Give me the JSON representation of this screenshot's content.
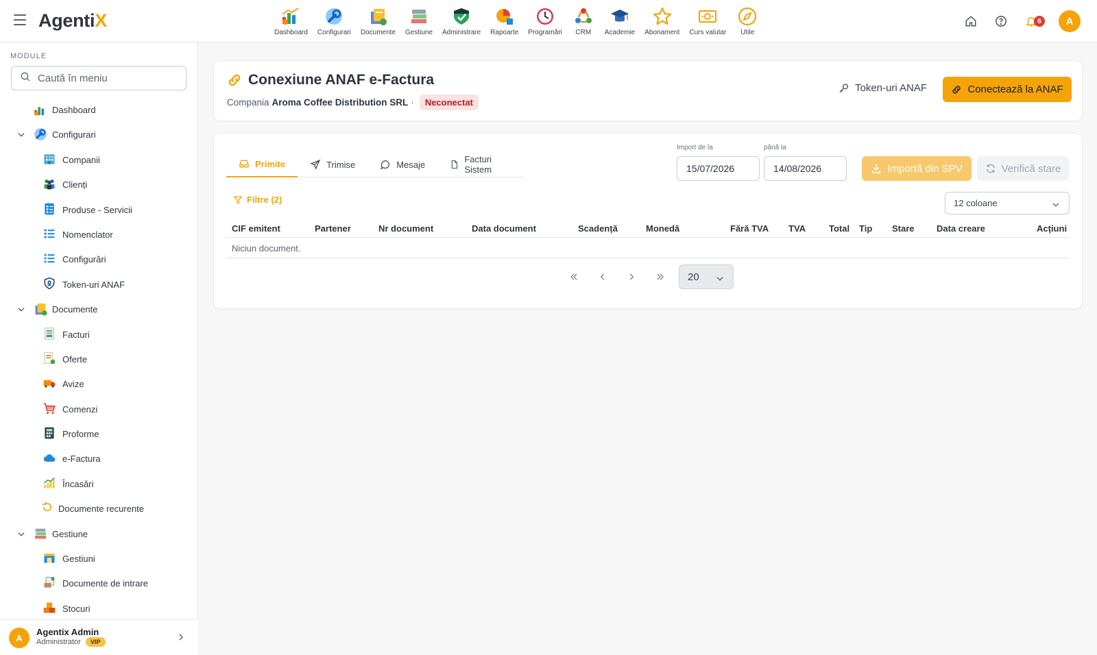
{
  "app": {
    "logo_main": "Agenti",
    "logo_accent": "X"
  },
  "top_nav": [
    {
      "label": "Dashboard",
      "icon": "dashboard-chart-icon"
    },
    {
      "label": "Configurari",
      "icon": "wrench-icon"
    },
    {
      "label": "Documente",
      "icon": "documents-icon"
    },
    {
      "label": "Gestiune",
      "icon": "books-stack-icon"
    },
    {
      "label": "Administrare",
      "icon": "shield-check-icon"
    },
    {
      "label": "Rapoarte",
      "icon": "report-pie-icon"
    },
    {
      "label": "Programări",
      "icon": "clock-icon"
    },
    {
      "label": "CRM",
      "icon": "crm-cycle-icon"
    },
    {
      "label": "Academie",
      "icon": "graduation-cap-icon"
    },
    {
      "label": "Abonament",
      "icon": "star-icon"
    },
    {
      "label": "Curs valutar",
      "icon": "banknote-icon"
    },
    {
      "label": "Utile",
      "icon": "compass-icon"
    }
  ],
  "top_right": {
    "notifications_count": "6",
    "avatar_initial": "A"
  },
  "sidebar": {
    "section_title": "MODULE",
    "search_placeholder": "Caută în meniu",
    "items": [
      {
        "label": "Dashboard",
        "level": 0,
        "icon": "dashboard-chart-icon"
      },
      {
        "label": "Configurari",
        "level": 0,
        "icon": "wrench-icon",
        "expanded": true
      },
      {
        "label": "Companii",
        "level": 1,
        "icon": "building-icon"
      },
      {
        "label": "Clienți",
        "level": 1,
        "icon": "people-icon"
      },
      {
        "label": "Produse - Servicii",
        "level": 1,
        "icon": "checklist-icon"
      },
      {
        "label": "Nomenclator",
        "level": 1,
        "icon": "list-icon"
      },
      {
        "label": "Configurări",
        "level": 1,
        "icon": "settings-list-icon"
      },
      {
        "label": "Token-uri ANAF",
        "level": 1,
        "icon": "shield-lock-icon"
      },
      {
        "label": "Documente",
        "level": 0,
        "icon": "documents-icon",
        "expanded": true
      },
      {
        "label": "Facturi",
        "level": 1,
        "icon": "invoice-icon"
      },
      {
        "label": "Oferte",
        "level": 1,
        "icon": "offer-icon"
      },
      {
        "label": "Avize",
        "level": 1,
        "icon": "truck-icon"
      },
      {
        "label": "Comenzi",
        "level": 1,
        "icon": "cart-icon"
      },
      {
        "label": "Proforme",
        "level": 1,
        "icon": "calculator-icon"
      },
      {
        "label": "e-Factura",
        "level": 1,
        "icon": "cloud-icon"
      },
      {
        "label": "Încasări",
        "level": 1,
        "icon": "growth-icon"
      },
      {
        "label": "Documente recurente",
        "level": 1,
        "icon": "recurring-icon"
      },
      {
        "label": "Gestiune",
        "level": 0,
        "icon": "books-stack-icon",
        "expanded": true
      },
      {
        "label": "Gestiuni",
        "level": 1,
        "icon": "warehouse-icon"
      },
      {
        "label": "Documente de intrare",
        "level": 1,
        "icon": "incoming-doc-icon"
      },
      {
        "label": "Stocuri",
        "level": 1,
        "icon": "boxes-icon"
      }
    ],
    "user": {
      "initial": "A",
      "name": "Agentix Admin",
      "role": "Administrator",
      "badge": "VIP"
    }
  },
  "header_card": {
    "title": "Conexiune ANAF e-Factura",
    "company_prefix": "Compania",
    "company_name": "Aroma Coffee Distribution SRL",
    "separator": "·",
    "status": "Neconectat",
    "token_link": "Token-uri ANAF",
    "connect_button": "Conectează la ANAF"
  },
  "main_card": {
    "tabs": [
      {
        "label": "Primite",
        "icon": "inbox-icon",
        "active": true
      },
      {
        "label": "Trimise",
        "icon": "send-icon",
        "active": false
      },
      {
        "label": "Mesaje",
        "icon": "message-icon",
        "active": false
      },
      {
        "label": "Facturi Sistem",
        "icon": "file-icon",
        "active": false
      }
    ],
    "import_from_label": "Import de la",
    "import_from_value": "15/07/2026",
    "import_to_label": "până la",
    "import_to_value": "14/08/2026",
    "import_button": "Importă din SPV",
    "verify_button": "Verifică stare",
    "filters_label": "Filtre (2)",
    "columns_select": "12 coloane",
    "table_headers": [
      "CIF emitent",
      "Partener",
      "Nr document",
      "Data document",
      "Scadență",
      "Monedă",
      "Fără TVA",
      "TVA",
      "Total",
      "Tip",
      "Stare",
      "Data creare",
      "Acțiuni"
    ],
    "empty_text": "Niciun document.",
    "page_size": "20"
  },
  "colors": {
    "accent": "#f5a30a",
    "accent_light": "#f8c86d",
    "danger": "#e53935",
    "status_bg": "#fde2e2",
    "status_fg": "#b91c1c"
  }
}
